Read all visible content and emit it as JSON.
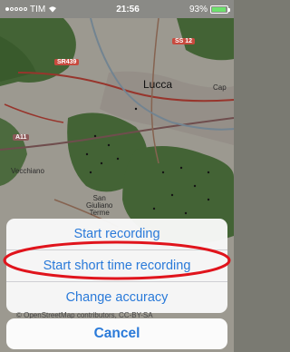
{
  "status_bar": {
    "carrier": "TIM",
    "time": "21:56",
    "battery_percent": "93%",
    "battery_level": 0.93,
    "wifi_icon": "wifi-icon",
    "battery_icon": "battery-icon"
  },
  "map": {
    "places": {
      "lucca": "Lucca",
      "vecchiano": "Vecchiano",
      "san_giuliano": "San\nGiuliano\nTerme",
      "capannori": "Cap"
    },
    "roads": {
      "ss12": "SS 12",
      "sr439": "SR439",
      "a11": "A11"
    },
    "attribution": "© OpenStreetMap contributors, CC-BY-SA",
    "colors": {
      "forest": "#5d8a4a",
      "land": "#d9d4c8",
      "urban": "#cfc6bd",
      "road_red": "#d24a3e"
    }
  },
  "action_sheet": {
    "options": [
      {
        "label": "Start recording"
      },
      {
        "label": "Start short time recording",
        "highlighted": true
      },
      {
        "label": "Change accuracy"
      }
    ],
    "cancel_label": "Cancel",
    "accent_color": "#2a7ad9",
    "highlight_color": "#e0141c"
  }
}
